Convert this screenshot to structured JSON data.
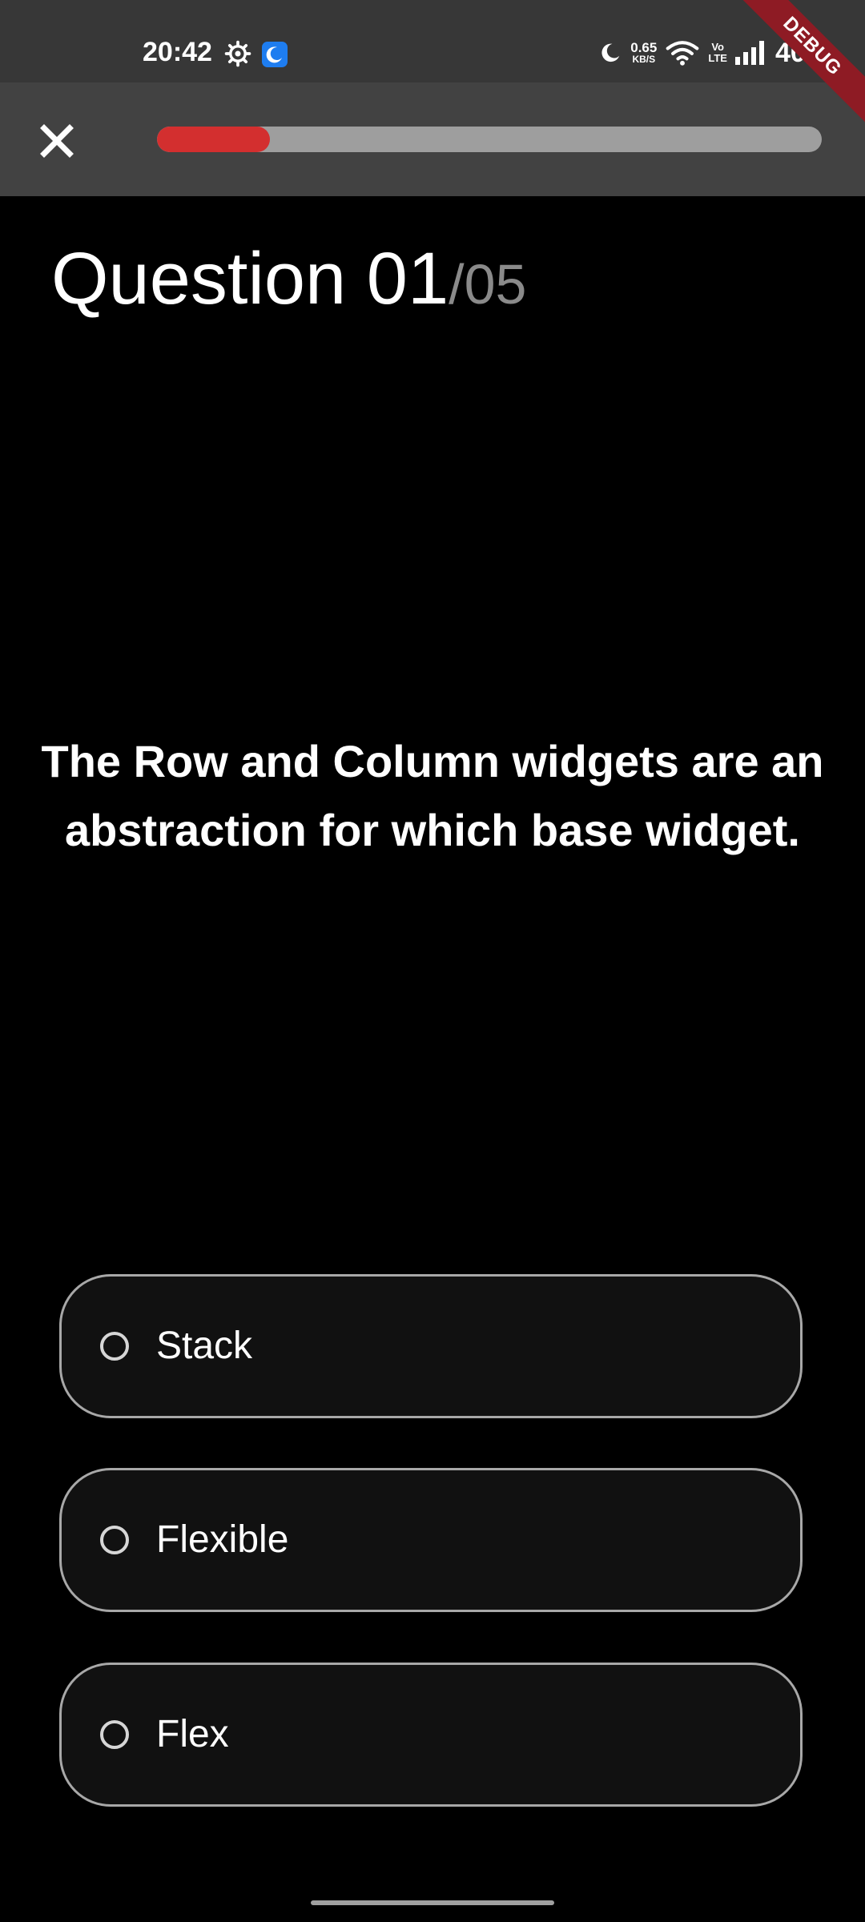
{
  "status_bar": {
    "time": "20:42",
    "speed_value": "0.65",
    "speed_unit": "KB/S",
    "volte_top": "Vo",
    "volte_bottom": "LTE",
    "battery": "40%",
    "icons": [
      "gear-icon",
      "moon-app-icon",
      "moon-icon",
      "wifi-icon",
      "signal-icon"
    ]
  },
  "debug_banner": "DEBUG",
  "app_bar": {
    "close_icon": "close-icon",
    "progress": 0.17,
    "progress_color": "#d32f2f",
    "track_color": "#9e9e9e"
  },
  "question": {
    "label": "Question 01",
    "total": "/05",
    "text": "The Row and Column widgets are an abstraction for which base widget."
  },
  "options": [
    {
      "label": "Stack",
      "selected": false
    },
    {
      "label": "Flexible",
      "selected": false
    },
    {
      "label": "Flex",
      "selected": false
    }
  ]
}
